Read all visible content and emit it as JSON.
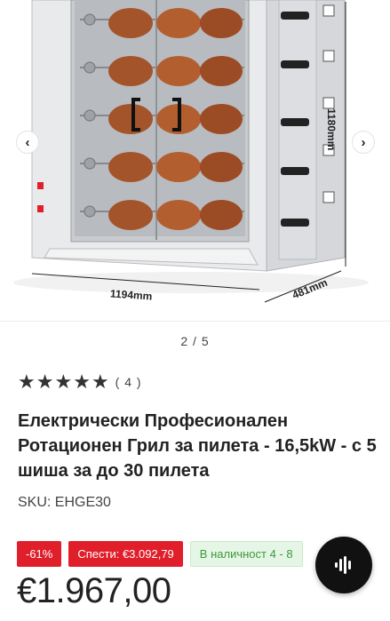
{
  "gallery": {
    "image_alt_icon": "rotisserie-grill-product-photo",
    "dimension_width": "1194mm",
    "dimension_depth": "481mm",
    "dimension_height": "1180mm",
    "prev_icon": "‹",
    "next_icon": "›",
    "pager": "2 / 5"
  },
  "rating": {
    "stars": 5,
    "count": "( 4 )"
  },
  "product": {
    "title": "Електрически Професионален Ротационен Грил за пилета - 16,5kW - с 5 шиша за до 30 пилета",
    "sku": "SKU: EHGE30",
    "discount_badge": "-61%",
    "savings_badge": "Спести: €3.092,79",
    "stock_badge": "В наличност 4 - 8",
    "price": "€1.967,00"
  },
  "colors": {
    "accent_red": "#e01f2b",
    "stock_green": "#3a9a3a",
    "fab_bg": "#111111"
  },
  "fab": {
    "icon": "voice-assistant-icon"
  }
}
